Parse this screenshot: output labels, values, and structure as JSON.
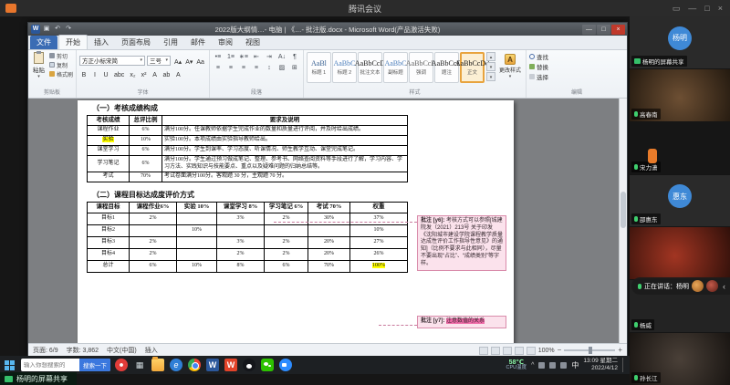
{
  "meeting": {
    "app_title": "腾讯会议",
    "controls": {
      "monitor": "▭",
      "min": "—",
      "max": "□",
      "close": "×"
    },
    "share_badge": "杨明的屏幕共享",
    "toast": {
      "text": "正在讲话：杨明",
      "collapse": "‹"
    },
    "participants": [
      {
        "name": "杨明的屏幕共享",
        "avatar": "杨明",
        "style": "",
        "share": true
      },
      {
        "name": "高春南",
        "style": "ph-brown"
      },
      {
        "name": "宋力潇",
        "style": "ph-orange"
      },
      {
        "name": "邵惠东",
        "avatar": "惠东",
        "style": ""
      },
      {
        "name": "",
        "style": "ph-red"
      },
      {
        "name": "杨威",
        "style": "ph-plain"
      },
      {
        "name": "孙长江",
        "style": "ph-dim"
      }
    ]
  },
  "word": {
    "title": "2022版大纲情…- 电脑 | 《…- 批注版.docx - Microsoft Word(产品激活失败)",
    "qat": [
      {
        "name": "word-logo-icon",
        "glyph": "W"
      },
      {
        "name": "save-icon",
        "glyph": "▣"
      },
      {
        "name": "undo-icon",
        "glyph": "↶"
      },
      {
        "name": "redo-icon",
        "glyph": "↷"
      }
    ],
    "controls": {
      "min": "—",
      "max": "□",
      "close": "×"
    },
    "tabs": [
      {
        "label": "文件",
        "type": "file"
      },
      {
        "label": "开始",
        "type": "active"
      },
      {
        "label": "插入"
      },
      {
        "label": "页面布局"
      },
      {
        "label": "引用"
      },
      {
        "label": "邮件"
      },
      {
        "label": "审阅"
      },
      {
        "label": "视图"
      }
    ],
    "clipboard": {
      "label": "剪贴板",
      "paste": "粘贴",
      "paste_caret": "▾",
      "items": [
        "剪切",
        "复制",
        "格式刷"
      ]
    },
    "font": {
      "label": "字体",
      "name": "方正小标宋简",
      "size": "三号",
      "caret": "▾",
      "row1_buttons": [
        {
          "name": "grow-font-button",
          "glyph": "A▴"
        },
        {
          "name": "shrink-font-button",
          "glyph": "A▾"
        },
        {
          "name": "clear-formatting-button",
          "glyph": "Aa"
        }
      ],
      "row2_buttons": [
        {
          "name": "bold-button",
          "glyph": "B"
        },
        {
          "name": "italic-button",
          "glyph": "I"
        },
        {
          "name": "underline-button",
          "glyph": "U"
        },
        {
          "name": "strikethrough-button",
          "glyph": "abc"
        },
        {
          "name": "subscript-button",
          "glyph": "x₂"
        },
        {
          "name": "superscript-button",
          "glyph": "x²"
        },
        {
          "name": "text-effects-button",
          "glyph": "A"
        },
        {
          "name": "highlight-color-button",
          "glyph": "ab"
        },
        {
          "name": "font-color-button",
          "glyph": "A"
        }
      ]
    },
    "paragraph": {
      "label": "段落",
      "row1": [
        {
          "name": "bullets-button",
          "glyph": "•≡"
        },
        {
          "name": "numbering-button",
          "glyph": "1≡"
        },
        {
          "name": "multilevel-list-button",
          "glyph": "∗≡"
        },
        {
          "name": "decrease-indent-button",
          "glyph": "⇤"
        },
        {
          "name": "increase-indent-button",
          "glyph": "⇥"
        },
        {
          "name": "sort-button",
          "glyph": "A↓"
        },
        {
          "name": "paragraph-marks-button",
          "glyph": "¶"
        }
      ],
      "row2": [
        {
          "name": "align-left-button",
          "glyph": "≡"
        },
        {
          "name": "align-center-button",
          "glyph": "≡"
        },
        {
          "name": "align-right-button",
          "glyph": "≡"
        },
        {
          "name": "justify-button",
          "glyph": "≡"
        },
        {
          "name": "line-spacing-button",
          "glyph": "↕"
        },
        {
          "name": "shading-button",
          "glyph": "▨"
        },
        {
          "name": "borders-button",
          "glyph": "⊞"
        }
      ]
    },
    "styles": {
      "label": "样式",
      "change": "更改样式",
      "caret": "▾",
      "change_icon": "A",
      "scroll": [
        "▴",
        "▾",
        "▾"
      ],
      "items": [
        {
          "preview": "AaBl",
          "name": "标题 1",
          "color": "#365f91"
        },
        {
          "preview": "AaBbC",
          "name": "标题 2",
          "color": "#4f81bd"
        },
        {
          "preview": "AaBbCcD",
          "name": "批注文本",
          "color": "#222222"
        },
        {
          "preview": "AaBbC",
          "name": "副标题",
          "color": "#4f81bd"
        },
        {
          "preview": "AaBbCcD",
          "name": "强调",
          "color": "#666666"
        },
        {
          "preview": "AaBbCcD",
          "name": "题注",
          "color": "#222222"
        },
        {
          "preview": "AaBbCcDd",
          "name": "正文",
          "color": "#111111",
          "selected": true
        }
      ]
    },
    "editing": {
      "label": "编辑",
      "items": [
        {
          "name": "find-button",
          "label": "查找"
        },
        {
          "name": "replace-button",
          "label": "替换"
        },
        {
          "name": "select-button",
          "label": "选择"
        }
      ]
    },
    "status": {
      "page": "页面: 6/9",
      "words": "字数: 3,862",
      "lang": "中文(中国)",
      "insert": "插入",
      "zoom": "100%",
      "zoom_out": "−",
      "zoom_in": "+"
    }
  },
  "document": {
    "section1_title": "（一）考核成绩构成",
    "table1": {
      "headers": [
        "考核成绩",
        "总评比例",
        "要求及说明"
      ],
      "rows": [
        [
          "课程作业",
          "6%",
          "满分100分。任课教师依据学生完成作业的数量和质量进行评阅，并及时给出成绩。"
        ],
        [
          "实验",
          "10%",
          "实验100分。本项成绩由实验指导教师给出。"
        ],
        [
          "课堂学习",
          "6%",
          "满分100分。学生到课率、学习态度、听课情况、师生教学互动、课堂完成笔记。"
        ],
        [
          "学习笔记",
          "6%",
          "满分100分。学生通过预习做成笔记、整理、参考书、网络查阅资料等手段进行了解，学习内容、学习方法、实践知识与技能要点、重点以及疑难问题的归纳总结等。"
        ],
        [
          "考试",
          "70%",
          "考试卷面满分100分。客观题 30 分，主观题 70 分。"
        ]
      ],
      "highlights": [
        [
          1,
          0
        ]
      ]
    },
    "section2_title": "（二）课程目标达成度评价方式",
    "table2": {
      "headers": [
        "课程目标",
        "课程作业6%",
        "实验 10%",
        "课堂学习 8%",
        "学习笔记 6%",
        "考试 70%",
        "权重"
      ],
      "rows": [
        [
          "目标1",
          "2%",
          "",
          "3%",
          "2%",
          "30%",
          "37%"
        ],
        [
          "目标2",
          "",
          "10%",
          "",
          "",
          "",
          "10%"
        ],
        [
          "目标3",
          "2%",
          "",
          "3%",
          "2%",
          "20%",
          "27%"
        ],
        [
          "目标4",
          "2%",
          "",
          "2%",
          "2%",
          "20%",
          "26%"
        ],
        [
          "总计",
          "6%",
          "10%",
          "8%",
          "6%",
          "70%",
          "100%"
        ]
      ],
      "highlights": [
        [
          4,
          6
        ]
      ]
    },
    "comments": [
      {
        "prefix": "批注 [y6]:",
        "text": "考核方式可以参照[城建院发（2021）213号 关于印发《沈阳城市建设学院课程教学质量达成性评价工作指导性意见》的通知]（比例不要求与此相同），尽量不要出现“占比”、“成绩类别”等字样。"
      },
      {
        "prefix": "批注 [y7]:",
        "text": "注意数值的关系",
        "highlight": true
      }
    ]
  },
  "taskbar": {
    "search_placeholder": "输入你想搜索的",
    "search_button": "搜索一下",
    "icons": [
      {
        "name": "browser-360-icon",
        "cls": "ic-360"
      },
      {
        "name": "task-view-icon",
        "cls": "ic-taskview",
        "glyph": "▦"
      },
      {
        "name": "file-explorer-icon",
        "cls": "ic-folder"
      },
      {
        "name": "ie-browser-icon",
        "cls": "ic-ie",
        "glyph": "e"
      },
      {
        "name": "chrome-icon",
        "cls": "ic-chrome"
      },
      {
        "name": "word-app-icon",
        "cls": "ic-word",
        "glyph": "W"
      },
      {
        "name": "wps-icon",
        "cls": "ic-wps",
        "glyph": "W"
      },
      {
        "name": "qq-icon",
        "cls": "ic-qq"
      },
      {
        "name": "wechat-icon",
        "cls": "ic-wechat"
      },
      {
        "name": "meeting-app-icon",
        "cls": "ic-meeting"
      }
    ],
    "cpu_temp": "58℃",
    "cpu_label": "CPU温度",
    "tray_caret": "^",
    "ime": "中",
    "time": "13:09 星期二",
    "date": "2022/4/12"
  }
}
